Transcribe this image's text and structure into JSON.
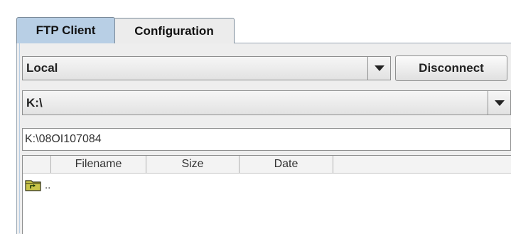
{
  "tabs": [
    {
      "label": "FTP Client",
      "active": true
    },
    {
      "label": "Configuration",
      "active": false
    }
  ],
  "location_combo": {
    "value": "Local"
  },
  "disconnect_button": {
    "label": "Disconnect"
  },
  "drive_combo": {
    "value": "K:\\"
  },
  "path_field": {
    "value": "K:\\08OI107084"
  },
  "file_table": {
    "columns": [
      "",
      "Filename",
      "Size",
      "Date"
    ],
    "rows": [
      {
        "icon": "parent-folder-icon",
        "name": ".."
      }
    ]
  },
  "colors": {
    "active_tab": "#b8cfe5",
    "panel_bg": "#eeeeee",
    "border": "#8e8f8f"
  }
}
